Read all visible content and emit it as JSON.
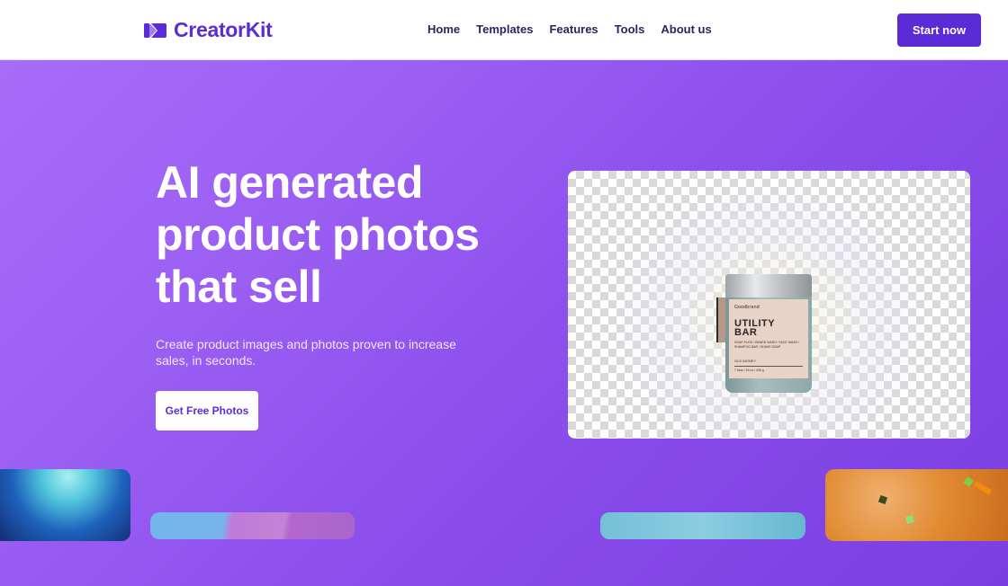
{
  "brand": {
    "name": "CreatorKit",
    "logo_icon": "play-video-icon",
    "color": "#5b2bd8"
  },
  "nav": {
    "links": [
      "Home",
      "Templates",
      "Features",
      "Tools",
      "About us"
    ],
    "cta_label": "Start now"
  },
  "hero": {
    "headline_lines": [
      "AI generated",
      "product photos",
      "that sell"
    ],
    "subtext": "Create product images and photos proven to increase sales, in seconds.",
    "button_label": "Get Free Photos",
    "image": {
      "description": "product jar on transparent checkerboard background",
      "product": {
        "brand": "Goodbrand",
        "title_lines": [
          "UTILITY",
          "BAR"
        ],
        "description": "SOAP PUCK / BEARD WASH / FACE WASH / SHAMPOO BAR / SHAVE SOAP",
        "scent": "OLD MONEY",
        "weight": "7 bars / 16 oz / 426 g"
      }
    }
  },
  "thumbnails": [
    {
      "name": "blue-nebula",
      "description": "blue smoke texture"
    },
    {
      "name": "blue-purple-gradient",
      "description": "blue and purple abstract"
    },
    {
      "name": "teal-water",
      "description": "teal water texture"
    },
    {
      "name": "orange-confetti",
      "description": "orange glitter with confetti"
    }
  ],
  "colors": {
    "accent": "#5b2bd8",
    "hero_gradient_start": "#a86cf9",
    "hero_gradient_end": "#7a3ee2",
    "nav_text": "#2e1f5e"
  }
}
